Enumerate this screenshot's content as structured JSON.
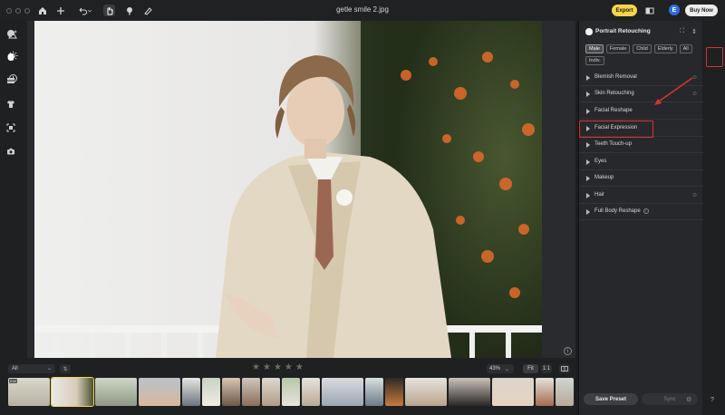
{
  "window": {
    "title": "getle smile 2.jpg"
  },
  "titlebar": {
    "export_label": "Export",
    "avatar_letter": "E",
    "buy_label": "Buy Now"
  },
  "panel": {
    "title": "Portrait Retouching",
    "filters": [
      "Male",
      "Female",
      "Child",
      "Elderly",
      "All",
      "Indiv."
    ],
    "selected_filter": "Male",
    "sections": [
      {
        "label": "Blemish Removal"
      },
      {
        "label": "Skin Retouching"
      },
      {
        "label": "Facial Reshape"
      },
      {
        "label": "Facial Expression"
      },
      {
        "label": "Teeth Touch-up"
      },
      {
        "label": "Eyes"
      },
      {
        "label": "Makeup"
      },
      {
        "label": "Hair"
      },
      {
        "label": "Full Body Reshape"
      }
    ],
    "save_preset_label": "Save Preset",
    "sync_label": "Sync"
  },
  "filmstrip": {
    "filter_value": "All",
    "zoom_value": "43%",
    "fit_label": "Fit",
    "one_to_one_label": "1:1",
    "rating_stars": 5,
    "rating_value": 0,
    "first_badge": "Edit"
  },
  "colors": {
    "accent": "#f7d54a",
    "annotation": "#d93333",
    "avatar": "#2f6ee5"
  },
  "icons": {
    "titlebar": [
      "home-icon",
      "plus-icon",
      "undo-icon",
      "hand-icon",
      "brush-icon",
      "eraser-icon",
      "split-view-icon"
    ],
    "leftrail": [
      "enhance-icon",
      "settings-icon",
      "history-icon"
    ],
    "rightrail": [
      "palette-icon",
      "portrait-icon",
      "film-icon",
      "shirt-icon",
      "face-scan-icon",
      "camera-icon"
    ]
  }
}
